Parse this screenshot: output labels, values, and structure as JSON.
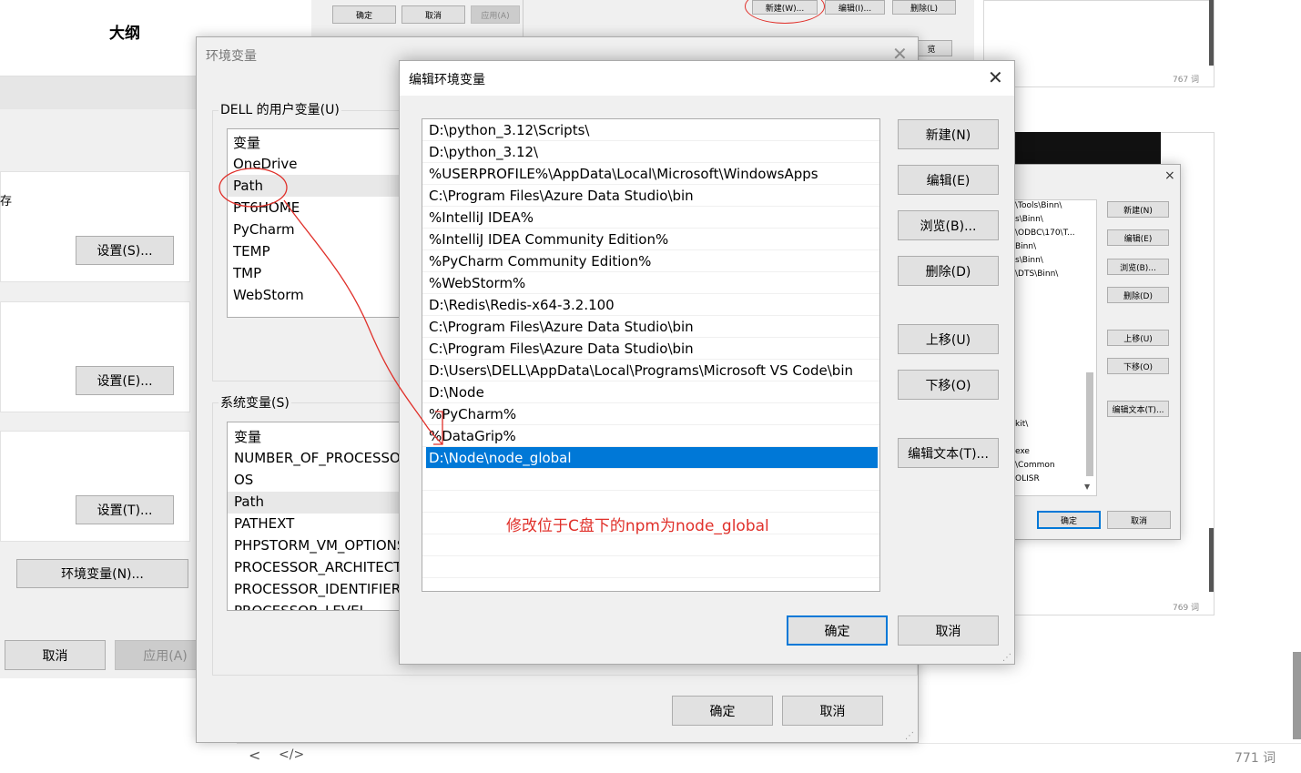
{
  "background": {
    "outline_title": "大纲",
    "save_fragment": "存",
    "buttons": {
      "settings_s": "设置(S)...",
      "settings_e": "设置(E)...",
      "settings_t": "设置(T)...",
      "env_vars": "环境变量(N)...",
      "cancel": "取消",
      "apply": "应用(A)"
    },
    "top_strip_buttons": {
      "ok": "确定",
      "cancel": "取消",
      "apply": "应用(A)"
    },
    "top_right_buttons": {
      "new": "新建(W)...",
      "edit": "编辑(I)...",
      "delete": "删除(L)",
      "partial": "览"
    },
    "word_counts": {
      "c767": "767 词",
      "c769": "769 词",
      "c771": "771 词"
    },
    "bottom_nav": {
      "back": "<",
      "code": "</>"
    }
  },
  "env_dialog": {
    "title": "环境变量",
    "user_group_label": "DELL 的用户变量(U)",
    "user_vars_header": "变量",
    "user_vars": [
      "OneDrive",
      "Path",
      "PT6HOME",
      "PyCharm",
      "TEMP",
      "TMP",
      "WebStorm"
    ],
    "system_group_label": "系统变量(S)",
    "system_vars_header": "变量",
    "system_vars": [
      "NUMBER_OF_PROCESSORS",
      "OS",
      "Path",
      "PATHEXT",
      "PHPSTORM_VM_OPTIONS",
      "PROCESSOR_ARCHITECTURE",
      "PROCESSOR_IDENTIFIER",
      "PROCESSOR_LEVEL"
    ],
    "ok": "确定",
    "cancel": "取消"
  },
  "edit_dialog": {
    "title": "编辑环境变量",
    "paths": [
      "D:\\python_3.12\\Scripts\\",
      "D:\\python_3.12\\",
      "%USERPROFILE%\\AppData\\Local\\Microsoft\\WindowsApps",
      "C:\\Program Files\\Azure Data Studio\\bin",
      "%IntelliJ IDEA%",
      "%IntelliJ IDEA Community Edition%",
      "%PyCharm Community Edition%",
      "%WebStorm%",
      "D:\\Redis\\Redis-x64-3.2.100",
      "C:\\Program Files\\Azure Data Studio\\bin",
      "C:\\Program Files\\Azure Data Studio\\bin",
      "D:\\Users\\DELL\\AppData\\Local\\Programs\\Microsoft VS Code\\bin",
      "D:\\Node",
      "%PyCharm%",
      "%DataGrip%",
      "D:\\Node\\node_global"
    ],
    "selected_index": 15,
    "buttons": {
      "new": "新建(N)",
      "edit": "编辑(E)",
      "browse": "浏览(B)...",
      "delete": "删除(D)",
      "move_up": "上移(U)",
      "move_down": "下移(O)",
      "edit_text": "编辑文本(T)..."
    },
    "ok": "确定",
    "cancel": "取消",
    "annotation": "修改位于C盘下的npm为node_global",
    "annotation_color": "#e0302a",
    "selection_color": "#0078d7"
  },
  "small_dialog": {
    "close": "×",
    "rows": [
      "\\Tools\\Binn\\",
      "s\\Binn\\",
      "\\ODBC\\170\\T...",
      "Binn\\",
      "s\\Binn\\",
      "\\DTS\\Binn\\",
      "kit\\",
      "exe",
      "\\Common",
      "OLISR"
    ],
    "buttons": {
      "new": "新建(N)",
      "edit": "编辑(E)",
      "browse": "浏览(B)...",
      "delete": "删除(D)",
      "move_up": "上移(U)",
      "move_down": "下移(O)",
      "edit_text": "编辑文本(T)..."
    },
    "ok": "确定",
    "cancel": "取消"
  }
}
